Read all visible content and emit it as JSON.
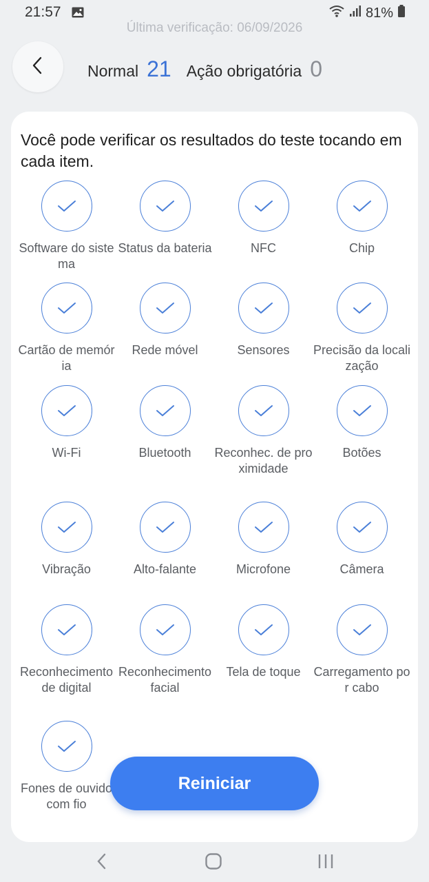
{
  "status_bar": {
    "time": "21:57",
    "battery": "81%",
    "icons": [
      "gallery-icon",
      "wifi-icon",
      "signal-icon",
      "battery-icon"
    ]
  },
  "last_check": "Última verificação: 06/09/2026",
  "header": {
    "normal_label": "Normal",
    "normal_count": "21",
    "action_label": "Ação obrigatória",
    "action_count": "0"
  },
  "intro": "Você pode verificar os resultados do teste tocando em cada item.",
  "tests": [
    {
      "label": "Software do sistema"
    },
    {
      "label": "Status da bateria"
    },
    {
      "label": "NFC"
    },
    {
      "label": "Chip"
    },
    {
      "label": "Cartão de memória"
    },
    {
      "label": "Rede móvel"
    },
    {
      "label": "Sensores"
    },
    {
      "label": "Precisão da localização"
    },
    {
      "label": "Wi-Fi"
    },
    {
      "label": "Bluetooth"
    },
    {
      "label": "Reconhec. de proximidade"
    },
    {
      "label": "Botões"
    },
    {
      "label": "Vibração"
    },
    {
      "label": "Alto-falante"
    },
    {
      "label": "Microfone"
    },
    {
      "label": "Câmera"
    },
    {
      "label": "Reconhecimento de digital"
    },
    {
      "label": "Reconhecimento facial"
    },
    {
      "label": "Tela de toque"
    },
    {
      "label": "Carregamento por cabo"
    },
    {
      "label": "Fones de ouvido com fio"
    }
  ],
  "restart_button": "Reiniciar",
  "colors": {
    "accent": "#3d7ef0",
    "check": "#4a7fd8",
    "background": "#eef0f2"
  }
}
